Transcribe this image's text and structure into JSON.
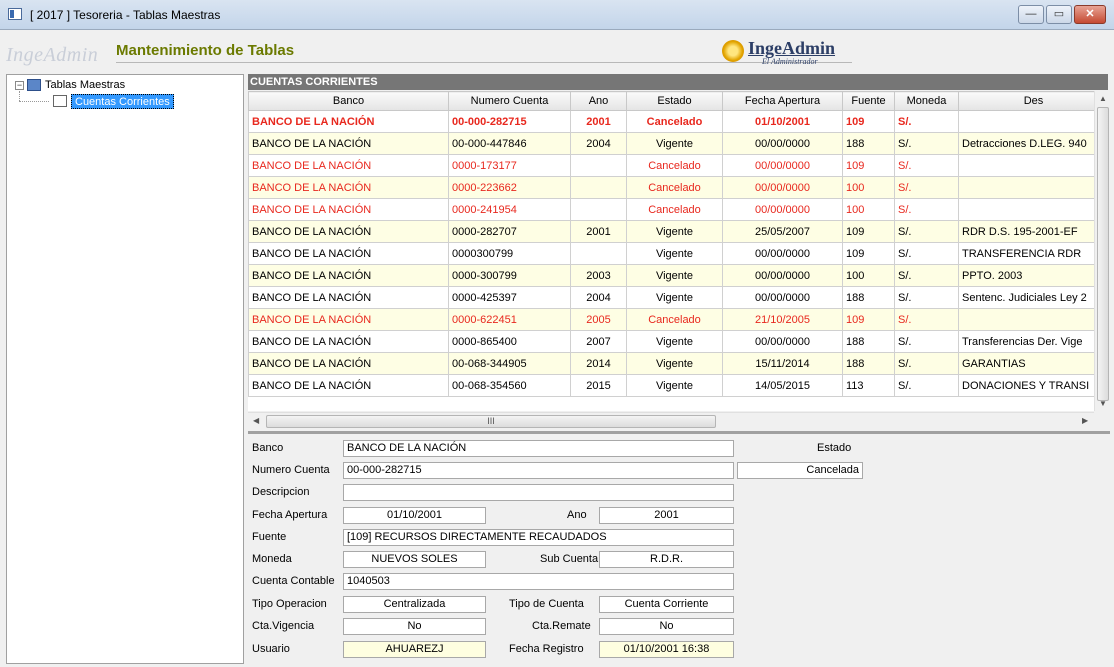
{
  "window": {
    "title": "[ 2017 ] Tesoreria - Tablas Maestras",
    "btn_min": "—",
    "btn_max": "▭",
    "btn_close": "✕"
  },
  "header": {
    "brand": "IngeAdmin",
    "module_title": "Mantenimiento de Tablas",
    "logo_text": "IngeAdmin",
    "logo_sub": "El Administrador"
  },
  "tree": {
    "root": "Tablas Maestras",
    "child": "Cuentas Corrientes",
    "expander": "−"
  },
  "grid": {
    "title": "CUENTAS CORRIENTES",
    "columns": [
      "Banco",
      "Numero Cuenta",
      "Ano",
      "Estado",
      "Fecha Apertura",
      "Fuente",
      "Moneda",
      "Des"
    ],
    "rows": [
      {
        "banco": "BANCO DE LA  NACIÓN",
        "cuenta": "00-000-282715",
        "ano": "2001",
        "estado": "Cancelado",
        "fecha": "01/10/2001",
        "fuente": "109",
        "moneda": "S/.",
        "des": ""
      },
      {
        "banco": "BANCO DE LA  NACIÓN",
        "cuenta": "00-000-447846",
        "ano": "2004",
        "estado": "Vigente",
        "fecha": "00/00/0000",
        "fuente": "188",
        "moneda": "S/.",
        "des": "Detracciones D.LEG. 940"
      },
      {
        "banco": "BANCO DE LA  NACIÓN",
        "cuenta": "0000-173177",
        "ano": "",
        "estado": "Cancelado",
        "fecha": "00/00/0000",
        "fuente": "109",
        "moneda": "S/.",
        "des": ""
      },
      {
        "banco": "BANCO DE LA  NACIÓN",
        "cuenta": "0000-223662",
        "ano": "",
        "estado": "Cancelado",
        "fecha": "00/00/0000",
        "fuente": "100",
        "moneda": "S/.",
        "des": ""
      },
      {
        "banco": "BANCO DE LA  NACIÓN",
        "cuenta": "0000-241954",
        "ano": "",
        "estado": "Cancelado",
        "fecha": "00/00/0000",
        "fuente": "100",
        "moneda": "S/.",
        "des": ""
      },
      {
        "banco": "BANCO DE LA  NACIÓN",
        "cuenta": "0000-282707",
        "ano": "2001",
        "estado": "Vigente",
        "fecha": "25/05/2007",
        "fuente": "109",
        "moneda": "S/.",
        "des": "RDR D.S. 195-2001-EF"
      },
      {
        "banco": "BANCO DE LA  NACIÓN",
        "cuenta": "0000300799",
        "ano": "",
        "estado": "Vigente",
        "fecha": "00/00/0000",
        "fuente": "109",
        "moneda": "S/.",
        "des": "TRANSFERENCIA RDR"
      },
      {
        "banco": "BANCO DE LA  NACIÓN",
        "cuenta": "0000-300799",
        "ano": "2003",
        "estado": "Vigente",
        "fecha": "00/00/0000",
        "fuente": "100",
        "moneda": "S/.",
        "des": "PPTO. 2003"
      },
      {
        "banco": "BANCO DE LA  NACIÓN",
        "cuenta": "0000-425397",
        "ano": "2004",
        "estado": "Vigente",
        "fecha": "00/00/0000",
        "fuente": "188",
        "moneda": "S/.",
        "des": "Sentenc. Judiciales Ley 2"
      },
      {
        "banco": "BANCO DE LA  NACIÓN",
        "cuenta": "0000-622451",
        "ano": "2005",
        "estado": "Cancelado",
        "fecha": "21/10/2005",
        "fuente": "109",
        "moneda": "S/.",
        "des": ""
      },
      {
        "banco": "BANCO DE LA  NACIÓN",
        "cuenta": "0000-865400",
        "ano": "2007",
        "estado": "Vigente",
        "fecha": "00/00/0000",
        "fuente": "188",
        "moneda": "S/.",
        "des": "Transferencias Der. Vige"
      },
      {
        "banco": "BANCO DE LA  NACIÓN",
        "cuenta": "00-068-344905",
        "ano": "2014",
        "estado": "Vigente",
        "fecha": "15/11/2014",
        "fuente": "188",
        "moneda": "S/.",
        "des": "GARANTIAS"
      },
      {
        "banco": "BANCO DE LA  NACIÓN",
        "cuenta": "00-068-354560",
        "ano": "2015",
        "estado": "Vigente",
        "fecha": "14/05/2015",
        "fuente": "113",
        "moneda": "S/.",
        "des": "DONACIONES Y TRANSI"
      }
    ],
    "scroll_grip": "III"
  },
  "detail": {
    "banco_label": "Banco",
    "banco_value": "BANCO DE LA  NACIÓN",
    "estado_label": "Estado",
    "estado_value": "Cancelada",
    "numero_label": "Numero Cuenta",
    "numero_value": "00-000-282715",
    "descripcion_label": "Descripcion",
    "descripcion_value": "",
    "fecha_label": "Fecha Apertura",
    "fecha_value": "01/10/2001",
    "ano_label": "Ano",
    "ano_value": "2001",
    "fuente_label": "Fuente",
    "fuente_value": "[109] RECURSOS DIRECTAMENTE RECAUDADOS",
    "moneda_label": "Moneda",
    "moneda_value": "NUEVOS SOLES",
    "subcuenta_label": "Sub Cuenta",
    "subcuenta_value": "R.D.R.",
    "contable_label": "Cuenta Contable",
    "contable_value": "1040503",
    "tipoop_label": "Tipo Operacion",
    "tipoop_value": "Centralizada",
    "tipocta_label": "Tipo de Cuenta",
    "tipocta_value": "Cuenta Corriente",
    "vigencia_label": "Cta.Vigencia",
    "vigencia_value": "No",
    "remate_label": "Cta.Remate",
    "remate_value": "No",
    "usuario_label": "Usuario",
    "usuario_value": "AHUAREZJ",
    "registro_label": "Fecha Registro",
    "registro_value": "01/10/2001  16:38"
  }
}
